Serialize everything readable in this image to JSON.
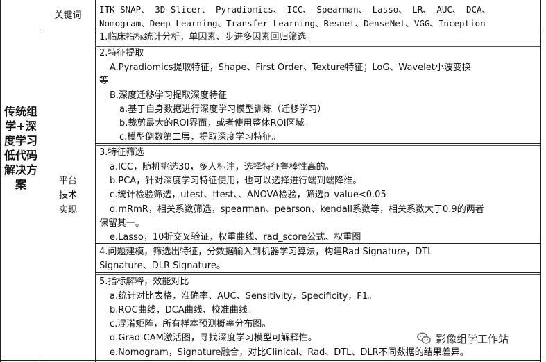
{
  "left_title": "传统组学+深度学习低代码解决方案",
  "keyword_label": "关键词",
  "keywords_line1": "ITK-SNAP、 3D Slicer、 Pyradiomics、 ICC、 Spearman、 Lasso、 LR、 AUC、 DCA、",
  "keywords_line2": "Nomogram、Deep Learning、Transfer Learning、Resnet、DenseNet、VGG、Inception",
  "platform_label_1": "平台",
  "platform_label_2": "技术",
  "platform_label_3": "实现",
  "sections": {
    "s1": "1.临床指标统计分析，单因素、步进多因素回归筛选。",
    "s2_title": "2.特征提取",
    "s2_a": "A.Pyradiomics提取特征，Shape、First Order、Texture特征；LoG、Wavelet小波变换",
    "s2_a2": "等",
    "s2_b": "B.深度迁移学习提取深度特征",
    "s2_b_a": "a.基于自身数据进行深度学习模型训练（迁移学习）",
    "s2_b_b": "b.裁剪最大的ROI界面，或者使用整体ROI区域。",
    "s2_b_c": "c.模型倒数第二层，提取深度学习特征。",
    "s3_title": "3.特征筛选",
    "s3_a": "a.ICC，随机挑选30，多人标注，选择特征鲁棒性高的。",
    "s3_b": "b.PCA，针对深度学习特征使用，也可以选择进行端到端降维。",
    "s3_c": "c.统计检验筛选，utest、ttest、、ANOVA检验，筛选p_value<0.05",
    "s3_d": "d.mRmR，相关系数筛选，spearman、pearson、kendall系数等，相关系数大于0.9的两者",
    "s3_d2": "保留其一。",
    "s3_e": "e.Lasso，10折交叉验证，权重曲线、rad_score公式、权重图",
    "s4": "4.问题建模，筛选出特征，分数据输入到机器学习算法，构建Rad Signature，DTL",
    "s4_2": "Signature、DLR Signature。",
    "s5_title": "5.指标解释，效能对比",
    "s5_a": "a.统计对比表格，准确率、AUC、Sensitivity，Specificity，F1。",
    "s5_b": "b.ROC曲线，DCA曲线、校准曲线。",
    "s5_c": "c.混淆矩阵，所有样本预测概率分布图。",
    "s5_d": "d.Grad-CAM激活图，寻找深度学习模型可解释性。",
    "s5_e": "e.Nomogram，Signature融合，对比Clinical、Rad、DTL、DLR不同数据的结果差异。"
  },
  "watermark": "影像组学工作站",
  "watermark_icon": "wechat-icon"
}
